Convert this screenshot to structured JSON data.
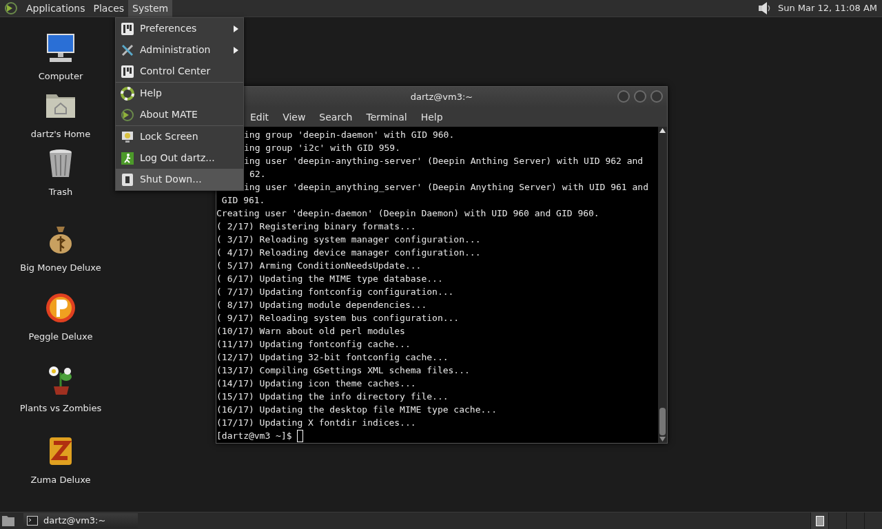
{
  "top_panel": {
    "menus": [
      {
        "label": "Applications",
        "selected": false
      },
      {
        "label": "Places",
        "selected": false
      },
      {
        "label": "System",
        "selected": true
      }
    ],
    "clock": "Sun Mar 12, 11:08 AM"
  },
  "system_menu": {
    "items": [
      {
        "label": "Preferences",
        "kind": "prefs",
        "submenu": true,
        "highlighted": false,
        "separator_before": false
      },
      {
        "label": "Administration",
        "kind": "admin",
        "submenu": true,
        "highlighted": false,
        "separator_before": false
      },
      {
        "label": "Control Center",
        "kind": "prefs",
        "submenu": false,
        "highlighted": false,
        "separator_before": false
      },
      {
        "label": "Help",
        "kind": "help",
        "submenu": false,
        "highlighted": false,
        "separator_before": true
      },
      {
        "label": "About MATE",
        "kind": "about",
        "submenu": false,
        "highlighted": false,
        "separator_before": false
      },
      {
        "label": "Lock Screen",
        "kind": "lock",
        "submenu": false,
        "highlighted": false,
        "separator_before": true
      },
      {
        "label": "Log Out dartz...",
        "kind": "logout",
        "submenu": false,
        "highlighted": false,
        "separator_before": false
      },
      {
        "label": "Shut Down...",
        "kind": "shutdown",
        "submenu": false,
        "highlighted": true,
        "separator_before": false
      }
    ]
  },
  "desktop_icons": [
    {
      "label": "Computer",
      "kind": "computer"
    },
    {
      "label": "dartz's Home",
      "kind": "home"
    },
    {
      "label": "Trash",
      "kind": "trash"
    },
    {
      "label": "Big Money Deluxe",
      "kind": "moneybag"
    },
    {
      "label": "Peggle Deluxe",
      "kind": "peggle"
    },
    {
      "label": "Plants vs Zombies",
      "kind": "plants"
    },
    {
      "label": "Zuma Deluxe",
      "kind": "zuma"
    }
  ],
  "terminal": {
    "title": "dartz@vm3:~",
    "menu": [
      "Edit",
      "View",
      "Search",
      "Terminal",
      "Help"
    ],
    "lines": [
      {
        "text": "ing group 'deepin-daemon' with GID 960.",
        "kind": "covered"
      },
      {
        "text": "ing group 'i2c' with GID 959.",
        "kind": "covered"
      },
      {
        "text": "ing user 'deepin-anything-server' (Deepin Anthing Server) with UID 962 and",
        "kind": "covered"
      },
      {
        "text": "62.",
        "kind": "covered_wrap"
      },
      {
        "text": "ing user 'deepin_anything_server' (Deepin Anything Server) with UID 961 and",
        "kind": "covered"
      },
      {
        "text": " GID 961.",
        "kind": "full"
      },
      {
        "text": "Creating user 'deepin-daemon' (Deepin Daemon) with UID 960 and GID 960.",
        "kind": "full"
      },
      {
        "text": "( 2/17) Registering binary formats...",
        "kind": "full"
      },
      {
        "text": "( 3/17) Reloading system manager configuration...",
        "kind": "full"
      },
      {
        "text": "( 4/17) Reloading device manager configuration...",
        "kind": "full"
      },
      {
        "text": "( 5/17) Arming ConditionNeedsUpdate...",
        "kind": "full"
      },
      {
        "text": "( 6/17) Updating the MIME type database...",
        "kind": "full"
      },
      {
        "text": "( 7/17) Updating fontconfig configuration...",
        "kind": "full"
      },
      {
        "text": "( 8/17) Updating module dependencies...",
        "kind": "full"
      },
      {
        "text": "( 9/17) Reloading system bus configuration...",
        "kind": "full"
      },
      {
        "text": "(10/17) Warn about old perl modules",
        "kind": "full"
      },
      {
        "text": "(11/17) Updating fontconfig cache...",
        "kind": "full"
      },
      {
        "text": "(12/17) Updating 32-bit fontconfig cache...",
        "kind": "full"
      },
      {
        "text": "(13/17) Compiling GSettings XML schema files...",
        "kind": "full"
      },
      {
        "text": "(14/17) Updating icon theme caches...",
        "kind": "full"
      },
      {
        "text": "(15/17) Updating the info directory file...",
        "kind": "full"
      },
      {
        "text": "(16/17) Updating the desktop file MIME type cache...",
        "kind": "full"
      },
      {
        "text": "(17/17) Updating X fontdir indices...",
        "kind": "full"
      }
    ],
    "prompt": "[dartz@vm3 ~]$ "
  },
  "bottom_panel": {
    "tasks": [
      {
        "label": "dartz@vm3:~",
        "selected": false
      }
    ],
    "workspaces": [
      {
        "selected": true
      },
      {
        "selected": false
      },
      {
        "selected": false
      },
      {
        "selected": false
      }
    ]
  }
}
